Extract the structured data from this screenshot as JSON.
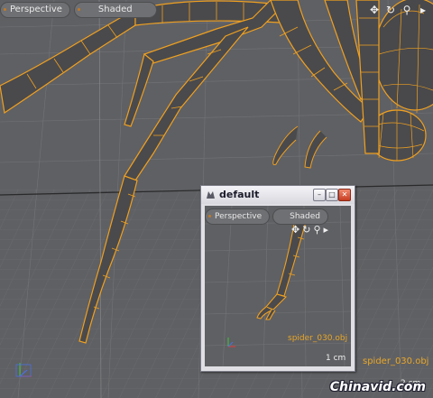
{
  "main_viewport": {
    "view_label": "Perspective",
    "shading_label": "Shaded",
    "object_name": "spider_030.obj",
    "unit": "2 cm",
    "nav_icons": [
      "move-icon",
      "rotate-icon",
      "zoom-icon",
      "expand-arrow-icon"
    ]
  },
  "floating_window": {
    "title": "default",
    "view_label": "Perspective",
    "shading_label": "Shaded",
    "object_name": "spider_030.obj",
    "unit": "1 cm",
    "buttons": [
      "minimize",
      "maximize",
      "close"
    ]
  },
  "watermark": "Chinavid.com",
  "colors": {
    "viewport_bg": "#5f6063",
    "wireframe": "#f0a020",
    "mesh_shade": "#4a4a4c",
    "label_orange": "#e8a628",
    "window_chrome": "#dfdfe4"
  }
}
